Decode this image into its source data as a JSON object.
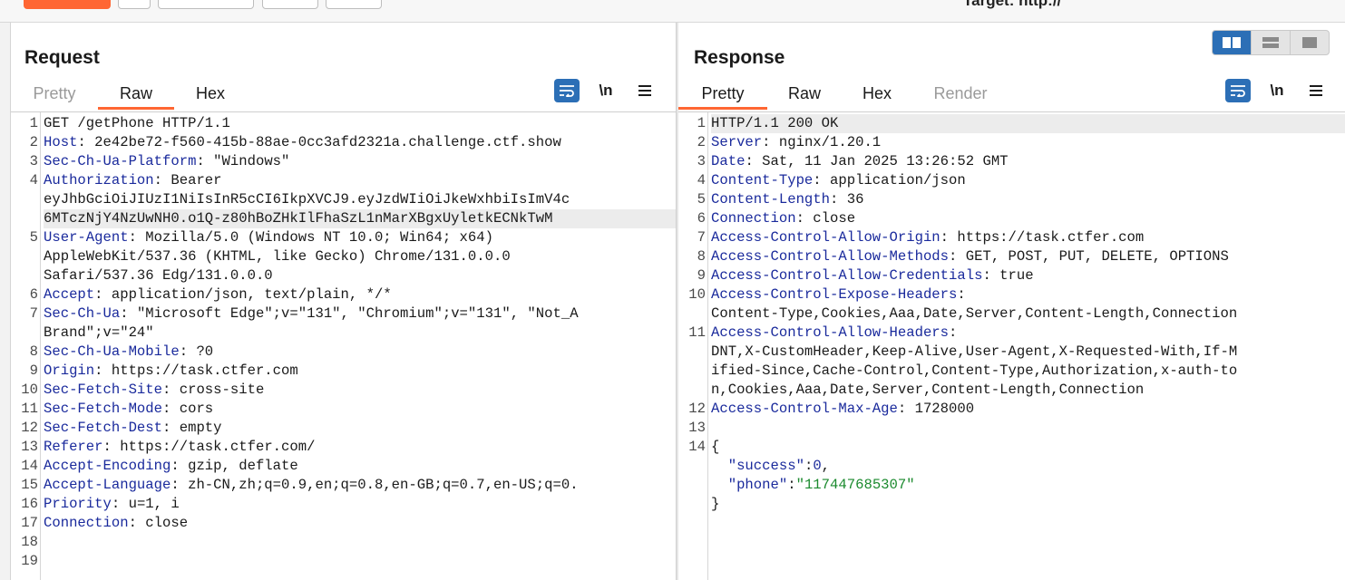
{
  "toolbar": {
    "target_partial": "Target: http://"
  },
  "layout_modes": [
    "side-by-side",
    "stacked-horizontal",
    "single"
  ],
  "request": {
    "title": "Request",
    "tabs": [
      {
        "label": "Pretty",
        "state": "muted"
      },
      {
        "label": "Raw",
        "state": "active"
      },
      {
        "label": "Hex",
        "state": "normal"
      }
    ],
    "tool_newline": "\\n",
    "lines": [
      {
        "n": "1",
        "rows": [
          [
            {
              "t": "GET /getPhone HTTP/1.1",
              "c": "hv"
            }
          ]
        ]
      },
      {
        "n": "2",
        "rows": [
          [
            {
              "t": "Host",
              "c": "hk"
            },
            {
              "t": ": 2e42be72-f560-415b-88ae-0cc3afd2321a.challenge.ctf.show",
              "c": "hv"
            }
          ]
        ]
      },
      {
        "n": "3",
        "rows": [
          [
            {
              "t": "Sec-Ch-Ua-Platform",
              "c": "hk"
            },
            {
              "t": ": \"Windows\"",
              "c": "hv"
            }
          ]
        ]
      },
      {
        "n": "4",
        "rows": [
          [
            {
              "t": "Authorization",
              "c": "hk"
            },
            {
              "t": ": Bearer",
              "c": "hv"
            }
          ],
          [
            {
              "t": "eyJhbGciOiJIUzI1NiIsInR5cCI6IkpXVCJ9.eyJzdWIiOiJkeWxhbiIsImV4c",
              "c": "hv"
            }
          ],
          [
            {
              "t": "6MTczNjY4NzUwNH0.o1Q-z80hBoZHkIlFhaSzL1nMarXBgxUyletkECNkTwM",
              "c": "hv",
              "hl": true
            }
          ]
        ]
      },
      {
        "n": "5",
        "rows": [
          [
            {
              "t": "User-Agent",
              "c": "hk"
            },
            {
              "t": ": Mozilla/5.0 (Windows NT 10.0; Win64; x64)",
              "c": "hv"
            }
          ],
          [
            {
              "t": "AppleWebKit/537.36 (KHTML, like Gecko) Chrome/131.0.0.0",
              "c": "hv"
            }
          ],
          [
            {
              "t": "Safari/537.36 Edg/131.0.0.0",
              "c": "hv"
            }
          ]
        ]
      },
      {
        "n": "6",
        "rows": [
          [
            {
              "t": "Accept",
              "c": "hk"
            },
            {
              "t": ": application/json, text/plain, */*",
              "c": "hv"
            }
          ]
        ]
      },
      {
        "n": "7",
        "rows": [
          [
            {
              "t": "Sec-Ch-Ua",
              "c": "hk"
            },
            {
              "t": ": \"Microsoft Edge\";v=\"131\", \"Chromium\";v=\"131\", \"Not_A",
              "c": "hv"
            }
          ],
          [
            {
              "t": "Brand\";v=\"24\"",
              "c": "hv"
            }
          ]
        ]
      },
      {
        "n": "8",
        "rows": [
          [
            {
              "t": "Sec-Ch-Ua-Mobile",
              "c": "hk"
            },
            {
              "t": ": ?0",
              "c": "hv"
            }
          ]
        ]
      },
      {
        "n": "9",
        "rows": [
          [
            {
              "t": "Origin",
              "c": "hk"
            },
            {
              "t": ": https://task.ctfer.com",
              "c": "hv"
            }
          ]
        ]
      },
      {
        "n": "10",
        "rows": [
          [
            {
              "t": "Sec-Fetch-Site",
              "c": "hk"
            },
            {
              "t": ": cross-site",
              "c": "hv"
            }
          ]
        ]
      },
      {
        "n": "11",
        "rows": [
          [
            {
              "t": "Sec-Fetch-Mode",
              "c": "hk"
            },
            {
              "t": ": cors",
              "c": "hv"
            }
          ]
        ]
      },
      {
        "n": "12",
        "rows": [
          [
            {
              "t": "Sec-Fetch-Dest",
              "c": "hk"
            },
            {
              "t": ": empty",
              "c": "hv"
            }
          ]
        ]
      },
      {
        "n": "13",
        "rows": [
          [
            {
              "t": "Referer",
              "c": "hk"
            },
            {
              "t": ": https://task.ctfer.com/",
              "c": "hv"
            }
          ]
        ]
      },
      {
        "n": "14",
        "rows": [
          [
            {
              "t": "Accept-Encoding",
              "c": "hk"
            },
            {
              "t": ": gzip, deflate",
              "c": "hv"
            }
          ]
        ]
      },
      {
        "n": "15",
        "rows": [
          [
            {
              "t": "Accept-Language",
              "c": "hk"
            },
            {
              "t": ": zh-CN,zh;q=0.9,en;q=0.8,en-GB;q=0.7,en-US;q=0.",
              "c": "hv"
            }
          ]
        ]
      },
      {
        "n": "16",
        "rows": [
          [
            {
              "t": "Priority",
              "c": "hk"
            },
            {
              "t": ": u=1, i",
              "c": "hv"
            }
          ]
        ]
      },
      {
        "n": "17",
        "rows": [
          [
            {
              "t": "Connection",
              "c": "hk"
            },
            {
              "t": ": close",
              "c": "hv"
            }
          ]
        ]
      },
      {
        "n": "18",
        "rows": [
          [
            {
              "t": "",
              "c": "hv"
            }
          ]
        ]
      },
      {
        "n": "19",
        "rows": [
          [
            {
              "t": "",
              "c": "hv"
            }
          ]
        ]
      }
    ]
  },
  "response": {
    "title": "Response",
    "tabs": [
      {
        "label": "Pretty",
        "state": "active"
      },
      {
        "label": "Raw",
        "state": "normal"
      },
      {
        "label": "Hex",
        "state": "normal"
      },
      {
        "label": "Render",
        "state": "muted"
      }
    ],
    "tool_newline": "\\n",
    "lines": [
      {
        "n": "1",
        "rows": [
          [
            {
              "t": "HTTP/1.1 200 OK",
              "c": "hv",
              "hl": true
            }
          ]
        ]
      },
      {
        "n": "2",
        "rows": [
          [
            {
              "t": "Server",
              "c": "hk"
            },
            {
              "t": ": nginx/1.20.1",
              "c": "hv"
            }
          ]
        ]
      },
      {
        "n": "3",
        "rows": [
          [
            {
              "t": "Date",
              "c": "hk"
            },
            {
              "t": ": Sat, 11 Jan 2025 13:26:52 GMT",
              "c": "hv"
            }
          ]
        ]
      },
      {
        "n": "4",
        "rows": [
          [
            {
              "t": "Content-Type",
              "c": "hk"
            },
            {
              "t": ": application/json",
              "c": "hv"
            }
          ]
        ]
      },
      {
        "n": "5",
        "rows": [
          [
            {
              "t": "Content-Length",
              "c": "hk"
            },
            {
              "t": ": 36",
              "c": "hv"
            }
          ]
        ]
      },
      {
        "n": "6",
        "rows": [
          [
            {
              "t": "Connection",
              "c": "hk"
            },
            {
              "t": ": close",
              "c": "hv"
            }
          ]
        ]
      },
      {
        "n": "7",
        "rows": [
          [
            {
              "t": "Access-Control-Allow-Origin",
              "c": "hk"
            },
            {
              "t": ": https://task.ctfer.com",
              "c": "hv"
            }
          ]
        ]
      },
      {
        "n": "8",
        "rows": [
          [
            {
              "t": "Access-Control-Allow-Methods",
              "c": "hk"
            },
            {
              "t": ": GET, POST, PUT, DELETE, OPTIONS",
              "c": "hv"
            }
          ]
        ]
      },
      {
        "n": "9",
        "rows": [
          [
            {
              "t": "Access-Control-Allow-Credentials",
              "c": "hk"
            },
            {
              "t": ": true",
              "c": "hv"
            }
          ]
        ]
      },
      {
        "n": "10",
        "rows": [
          [
            {
              "t": "Access-Control-Expose-Headers",
              "c": "hk"
            },
            {
              "t": ":",
              "c": "hv"
            }
          ],
          [
            {
              "t": "Content-Type,Cookies,Aaa,Date,Server,Content-Length,Connection",
              "c": "hv"
            }
          ]
        ]
      },
      {
        "n": "11",
        "rows": [
          [
            {
              "t": "Access-Control-Allow-Headers",
              "c": "hk"
            },
            {
              "t": ":",
              "c": "hv"
            }
          ],
          [
            {
              "t": "DNT,X-CustomHeader,Keep-Alive,User-Agent,X-Requested-With,If-M",
              "c": "hv"
            }
          ],
          [
            {
              "t": "ified-Since,Cache-Control,Content-Type,Authorization,x-auth-to",
              "c": "hv"
            }
          ],
          [
            {
              "t": "n,Cookies,Aaa,Date,Server,Content-Length,Connection",
              "c": "hv"
            }
          ]
        ]
      },
      {
        "n": "12",
        "rows": [
          [
            {
              "t": "Access-Control-Max-Age",
              "c": "hk"
            },
            {
              "t": ": 1728000",
              "c": "hv"
            }
          ]
        ]
      },
      {
        "n": "13",
        "rows": [
          [
            {
              "t": "",
              "c": "hv"
            }
          ]
        ]
      },
      {
        "n": "14",
        "rows": [
          [
            {
              "t": "{",
              "c": "jp"
            }
          ],
          [
            {
              "t": "  ",
              "c": "jp"
            },
            {
              "t": "\"success\"",
              "c": "jk"
            },
            {
              "t": ":",
              "c": "jp"
            },
            {
              "t": "0",
              "c": "jn"
            },
            {
              "t": ",",
              "c": "jp"
            }
          ],
          [
            {
              "t": "  ",
              "c": "jp"
            },
            {
              "t": "\"phone\"",
              "c": "jk"
            },
            {
              "t": ":",
              "c": "jp"
            },
            {
              "t": "\"117447685307\"",
              "c": "js"
            }
          ],
          [
            {
              "t": "}",
              "c": "jp"
            }
          ]
        ]
      }
    ]
  },
  "colors": {
    "accent_orange": "#ff6633",
    "accent_blue": "#2c6fb6",
    "header_key": "#1a2a9c",
    "json_string": "#1b8a2e"
  }
}
